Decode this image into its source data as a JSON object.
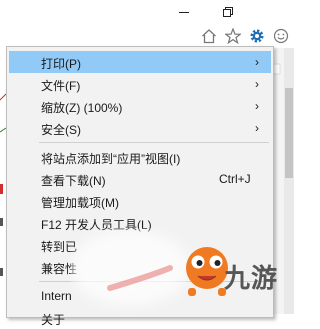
{
  "menu": {
    "items": [
      {
        "label": "打印(P)",
        "has_submenu": true
      },
      {
        "label": "文件(F)",
        "has_submenu": true
      },
      {
        "label": "缩放(Z) (100%)",
        "has_submenu": true
      },
      {
        "label": "安全(S)",
        "has_submenu": true
      },
      {
        "label": "将站点添加到“应用”视图(I)"
      },
      {
        "label": "查看下载(N)",
        "shortcut": "Ctrl+J"
      },
      {
        "label": "管理加载项(M)"
      },
      {
        "label": "F12 开发人员工具(L)"
      },
      {
        "label": "转到已"
      },
      {
        "label": "兼容性"
      },
      {
        "label": "Intern"
      },
      {
        "label": "关于"
      }
    ],
    "submenu_arrow": "›",
    "highlight_color": "#91c9f7"
  },
  "window_controls": {
    "minimize": "minimize-icon",
    "restore": "restore-icon"
  },
  "toolbar": {
    "home": "home-icon",
    "favorites": "star-icon",
    "tools": "gear-icon",
    "feedback": "smiley-icon"
  },
  "watermark": {
    "text": "九游"
  }
}
